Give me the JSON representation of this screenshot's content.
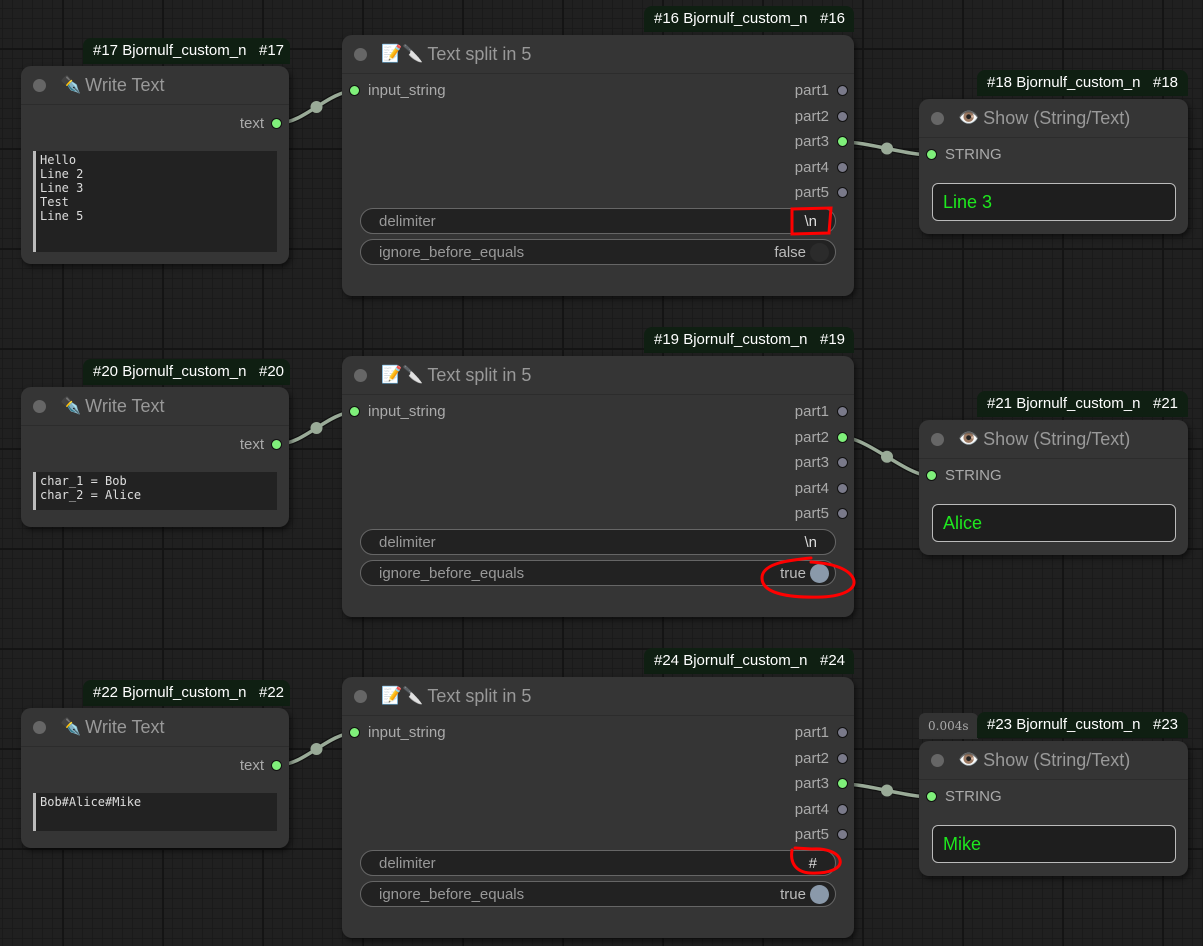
{
  "groups": [
    {
      "write": {
        "badge_name": "#17 Bjornulf_custom_n",
        "badge_id": "#17",
        "title_icon": "✒️",
        "title": "Write Text",
        "output_label": "text",
        "text": "Hello\nLine 2\nLine 3\nTest\nLine 5"
      },
      "split": {
        "badge_name": "#16 Bjornulf_custom_n",
        "badge_id": "#16",
        "title_icon": "📝🔪",
        "title": "Text split in 5",
        "input_label": "input_string",
        "outputs": [
          "part1",
          "part2",
          "part3",
          "part4",
          "part5"
        ],
        "connected_output": "part3",
        "delimiter_label": "delimiter",
        "delimiter_value": "\\n",
        "ignore_label": "ignore_before_equals",
        "ignore_value": "false",
        "highlighted": "delimiter"
      },
      "show": {
        "badge_name": "#18 Bjornulf_custom_n",
        "badge_id": "#18",
        "title_icon": "👁️",
        "title": "Show (String/Text)",
        "input_label": "STRING",
        "value": "Line 3"
      }
    },
    {
      "write": {
        "badge_name": "#20 Bjornulf_custom_n",
        "badge_id": "#20",
        "title_icon": "✒️",
        "title": "Write Text",
        "output_label": "text",
        "text": "char_1 = Bob\nchar_2 = Alice"
      },
      "split": {
        "badge_name": "#19 Bjornulf_custom_n",
        "badge_id": "#19",
        "title_icon": "📝🔪",
        "title": "Text split in 5",
        "input_label": "input_string",
        "outputs": [
          "part1",
          "part2",
          "part3",
          "part4",
          "part5"
        ],
        "connected_output": "part2",
        "delimiter_label": "delimiter",
        "delimiter_value": "\\n",
        "ignore_label": "ignore_before_equals",
        "ignore_value": "true",
        "highlighted": "ignore"
      },
      "show": {
        "badge_name": "#21 Bjornulf_custom_n",
        "badge_id": "#21",
        "title_icon": "👁️",
        "title": "Show (String/Text)",
        "input_label": "STRING",
        "value": "Alice"
      }
    },
    {
      "write": {
        "badge_name": "#22 Bjornulf_custom_n",
        "badge_id": "#22",
        "title_icon": "✒️",
        "title": "Write Text",
        "output_label": "text",
        "text": "Bob#Alice#Mike"
      },
      "split": {
        "badge_name": "#24 Bjornulf_custom_n",
        "badge_id": "#24",
        "title_icon": "📝🔪",
        "title": "Text split in 5",
        "input_label": "input_string",
        "outputs": [
          "part1",
          "part2",
          "part3",
          "part4",
          "part5"
        ],
        "connected_output": "part3",
        "delimiter_label": "delimiter",
        "delimiter_value": "#",
        "ignore_label": "ignore_before_equals",
        "ignore_value": "true",
        "highlighted": "delimiter"
      },
      "show": {
        "badge_name": "#23 Bjornulf_custom_n",
        "badge_id": "#23",
        "title_icon": "👁️",
        "title": "Show (String/Text)",
        "input_label": "STRING",
        "value": "Mike",
        "timing": "0.004s"
      }
    }
  ],
  "colors": {
    "canvas_bg": "#202020",
    "node_bg": "#353535",
    "badge_bg": "#0f1f12",
    "connected_slot": "#7ff07a",
    "unconnected_slot": "#7a7a8a",
    "link": "#9aab98",
    "output_text": "#1ee81e",
    "annotation": "#ff0000"
  }
}
